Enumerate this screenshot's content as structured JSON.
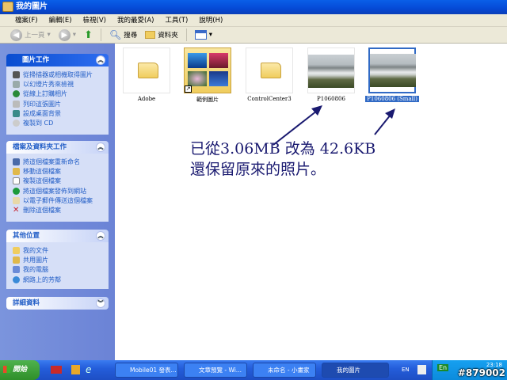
{
  "window": {
    "title": "我的圖片"
  },
  "menu": [
    "檔案(F)",
    "編輯(E)",
    "檢視(V)",
    "我的最愛(A)",
    "工具(T)",
    "說明(H)"
  ],
  "toolbar": {
    "back": "上一頁",
    "search": "搜尋",
    "folders": "資料夾"
  },
  "sidebar": {
    "picture_tasks": {
      "title": "圖片工作",
      "items": [
        "從掃描器或相機取得圖片",
        "以幻燈片秀來檢視",
        "從線上訂購相片",
        "列印這張圖片",
        "設成桌面背景",
        "複製到 CD"
      ]
    },
    "file_tasks": {
      "title": "檔案及資料夾工作",
      "items": [
        "將這個檔案重新命名",
        "移動這個檔案",
        "複製這個檔案",
        "將這個檔案發佈到網站",
        "以電子郵件傳送這個檔案",
        "刪除這個檔案"
      ]
    },
    "other_places": {
      "title": "其他位置",
      "items": [
        "我的文件",
        "共用圖片",
        "我的電腦",
        "網路上的芳鄰"
      ]
    },
    "details": {
      "title": "詳細資料"
    }
  },
  "files": [
    {
      "name": "Adobe",
      "type": "folder"
    },
    {
      "name": "範例圖片",
      "type": "shortcut-folder"
    },
    {
      "name": "ControlCenter3",
      "type": "folder"
    },
    {
      "name": "P1060806",
      "type": "image"
    },
    {
      "name": "P1060806 (Small)",
      "type": "image",
      "selected": true
    }
  ],
  "note": {
    "line1": "已從3.06MB 改為 42.6KB",
    "line2": "還保留原來的照片。"
  },
  "taskbar": {
    "start": "開始",
    "items": [
      "Mobile01 發表...",
      "文章預覽 - Wi...",
      "未命名 - 小畫家",
      "我的圖片"
    ],
    "lang": "EN",
    "ime": "En",
    "clock": "23:18",
    "watermark": "#879002"
  }
}
